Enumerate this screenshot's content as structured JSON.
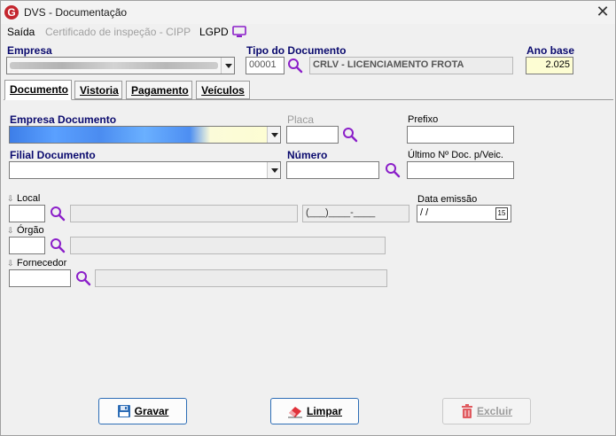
{
  "window": {
    "title": "DVS - Documentação",
    "close_glyph": "✕",
    "logo_letter": "G"
  },
  "menu": {
    "saida": "Saída",
    "certificado": "Certificado de inspeção - CIPP",
    "lgpd": "LGPD"
  },
  "header": {
    "empresa_label": "Empresa",
    "tipo_label": "Tipo do Documento",
    "tipo_code": "00001",
    "tipo_desc": "CRLV - LICENCIAMENTO FROTA",
    "ano_label": "Ano base",
    "ano_value": "2.025"
  },
  "tabs": [
    {
      "label": "Documento"
    },
    {
      "label": "Vistoria"
    },
    {
      "label": "Pagamento"
    },
    {
      "label": "Veículos"
    }
  ],
  "form": {
    "empresa_doc_label": "Empresa Documento",
    "placa_label": "Placa",
    "prefixo_label": "Prefixo",
    "filial_label": "Filial Documento",
    "numero_label": "Número",
    "ultimo_label": "Último Nº Doc. p/Veic.",
    "local_label": "Local",
    "cep_mask": "(___)____-____",
    "data_label": "Data emissão",
    "data_value": " /  /",
    "calendar_day": "15",
    "orgao_label": "Órgão",
    "fornecedor_label": "Fornecedor"
  },
  "buttons": {
    "gravar": "Gravar",
    "limpar": "Limpar",
    "excluir": "Excluir"
  },
  "colors": {
    "accent": "#2d6db6",
    "label_blue": "#0a0a6e",
    "search_purple": "#8b1fc9",
    "yellow_field": "#fdfdd3",
    "logo_red": "#c4262e"
  }
}
